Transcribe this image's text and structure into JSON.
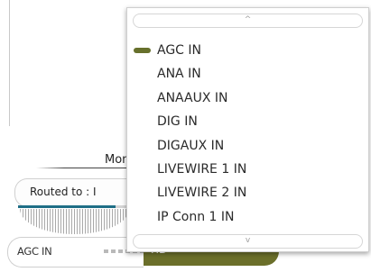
{
  "background_panel": {
    "monitor_label": "Mon",
    "routed_label": "Routed to : I",
    "meter_level": 0.88,
    "source_select_value": "AGC IN",
    "hd_button_label": "HD"
  },
  "dropdown": {
    "scroll_up_glyph": "^",
    "scroll_down_glyph": "v",
    "selected_index": 0,
    "options": [
      "AGC IN",
      "ANA IN",
      "ANAAUX IN",
      "DIG IN",
      "DIGAUX IN",
      "LIVEWIRE 1 IN",
      "LIVEWIRE 2 IN",
      "IP Conn 1 IN"
    ]
  },
  "colors": {
    "accent": "#67702c",
    "meter": "#1f6e86",
    "hd_button": "#6b6f2a"
  }
}
